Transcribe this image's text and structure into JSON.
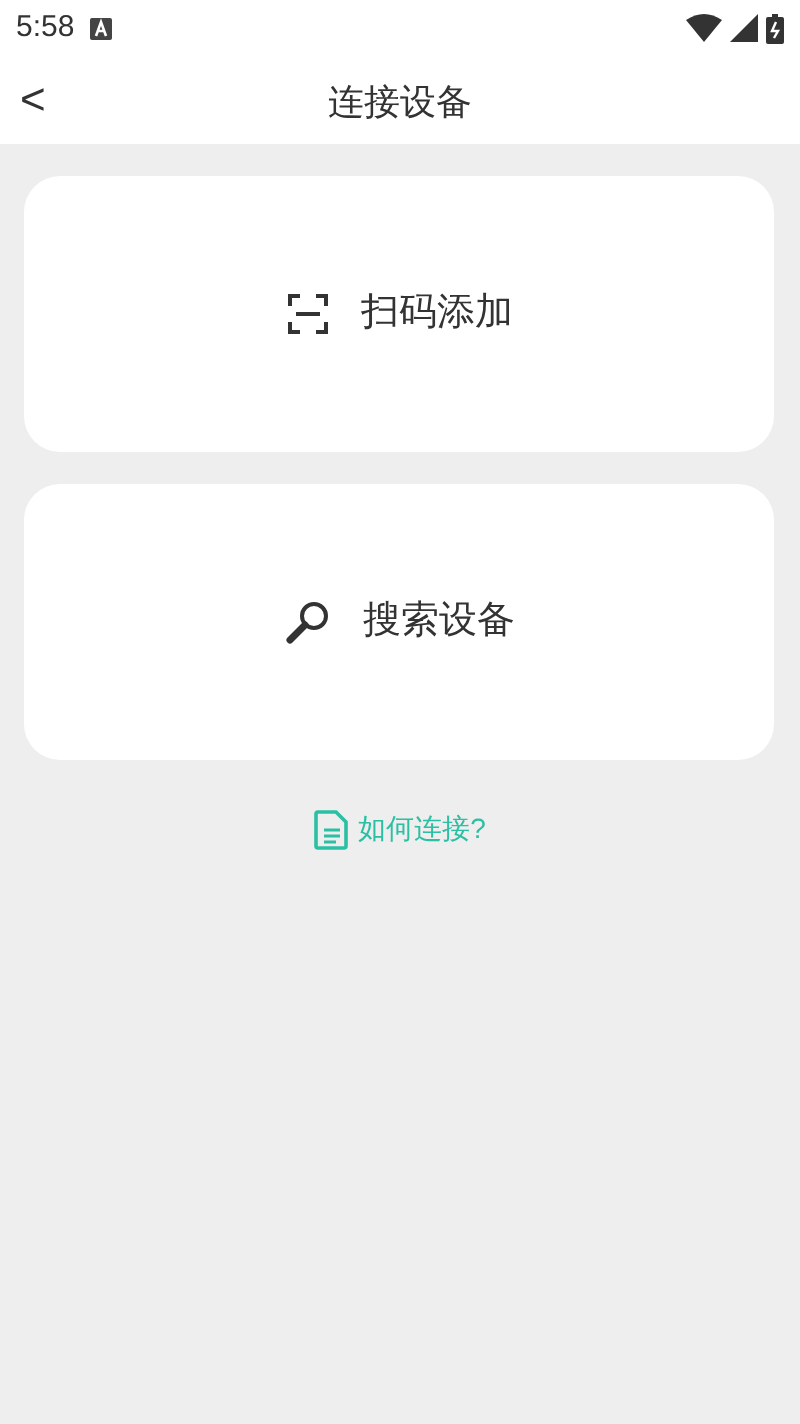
{
  "status_bar": {
    "time": "5:58"
  },
  "header": {
    "back": "<",
    "title": "连接设备"
  },
  "options": [
    {
      "kind": "scan",
      "label": "扫码添加"
    },
    {
      "kind": "search",
      "label": "搜索设备"
    }
  ],
  "help_link": {
    "label": "如何连接?"
  }
}
